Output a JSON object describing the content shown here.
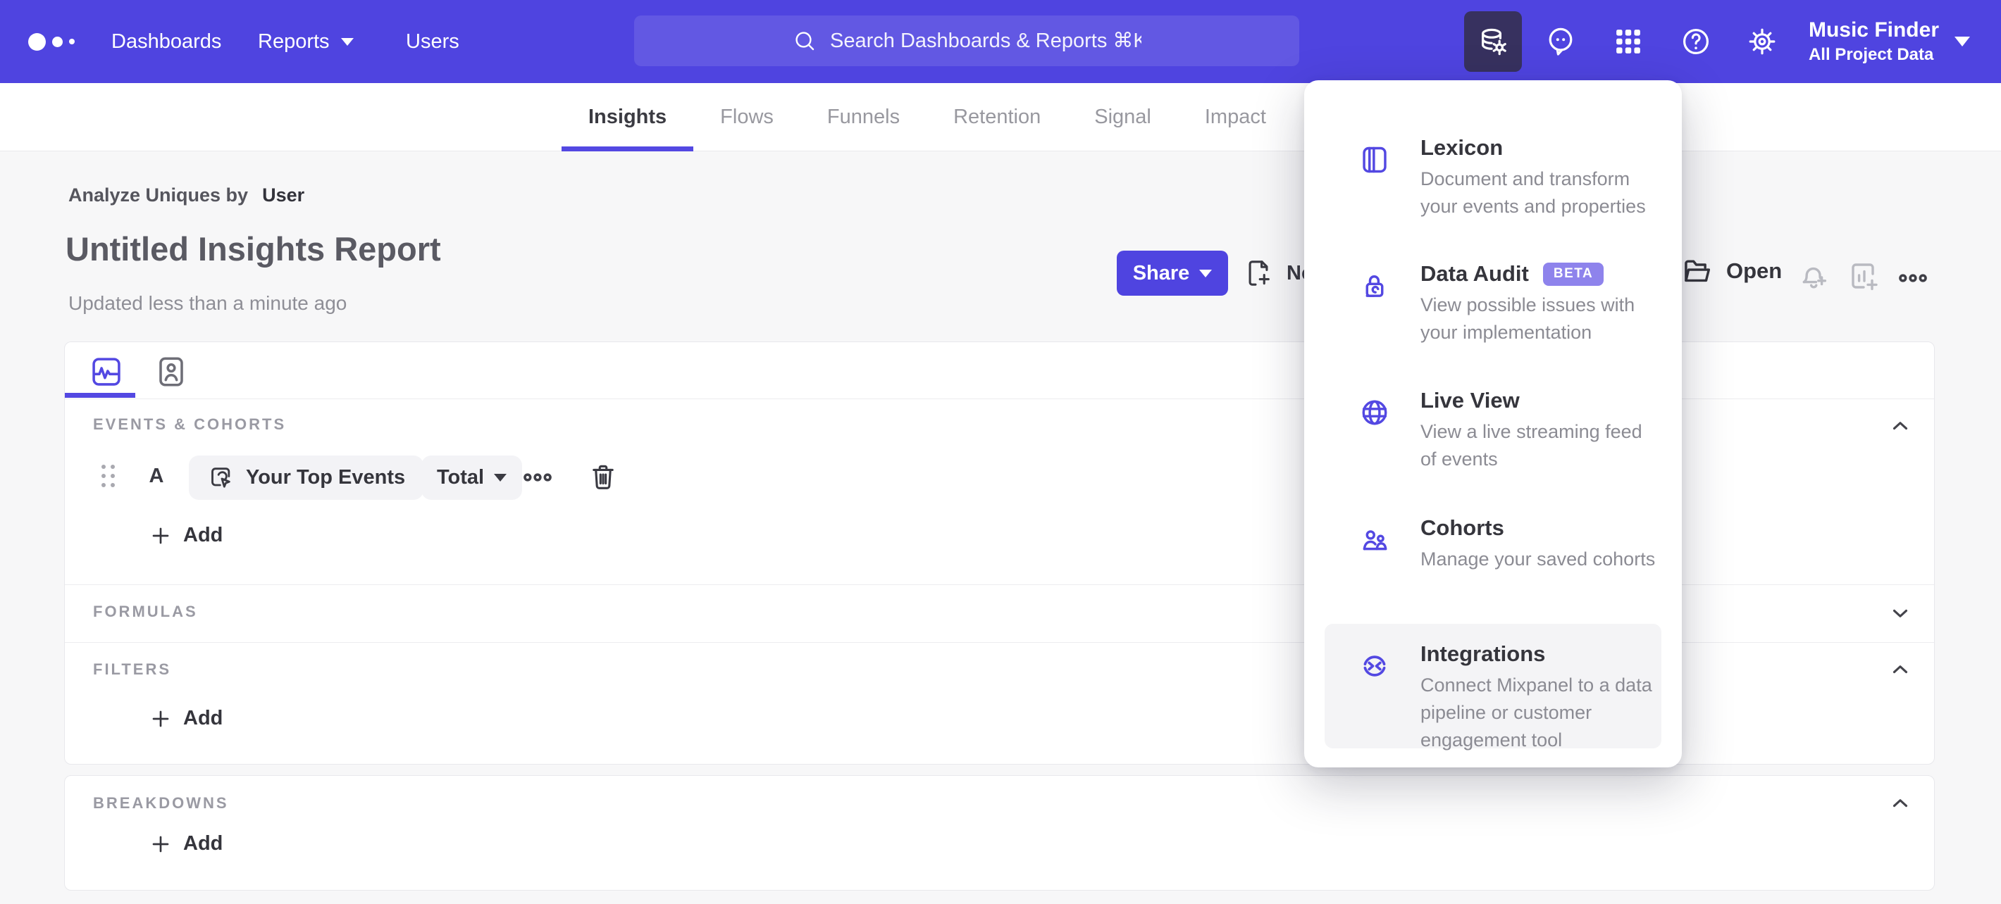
{
  "colors": {
    "nav_background": "#4f44e0",
    "accent": "#5348e2",
    "beta_badge": "#8e83ec",
    "page_background": "#f7f7f8"
  },
  "topnav": {
    "items": [
      "Dashboards",
      "Reports",
      "Users"
    ],
    "search_placeholder": "Search Dashboards & Reports ⌘K",
    "project_name": "Music Finder",
    "project_scope": "All Project Data"
  },
  "report_tabs": {
    "items": [
      "Insights",
      "Flows",
      "Funnels",
      "Retention",
      "Signal",
      "Impact"
    ],
    "active": "Insights"
  },
  "header": {
    "analyze_label": "Analyze Uniques by",
    "analyze_value": "User",
    "title": "Untitled Insights Report",
    "updated": "Updated less than a minute ago",
    "share": "Share",
    "new_board_partial": "Ne",
    "open": "Open"
  },
  "builder": {
    "events_header": "EVENTS & COHORTS",
    "row": {
      "label": "A",
      "event": "Your Top Events",
      "aggregation": "Total"
    },
    "add_label": "Add",
    "formulas_header": "FORMULAS",
    "filters_header": "FILTERS",
    "breakdowns_header": "BREAKDOWNS"
  },
  "menu": {
    "items": [
      {
        "title": "Lexicon",
        "description": "Document and transform your events and properties"
      },
      {
        "title": "Data Audit",
        "badge": "BETA",
        "description": "View possible issues with your implementation"
      },
      {
        "title": "Live View",
        "description": "View a live streaming feed of events"
      },
      {
        "title": "Cohorts",
        "description": "Manage your saved cohorts"
      },
      {
        "title": "Integrations",
        "description": "Connect Mixpanel to a data pipeline or customer engagement tool"
      }
    ]
  }
}
